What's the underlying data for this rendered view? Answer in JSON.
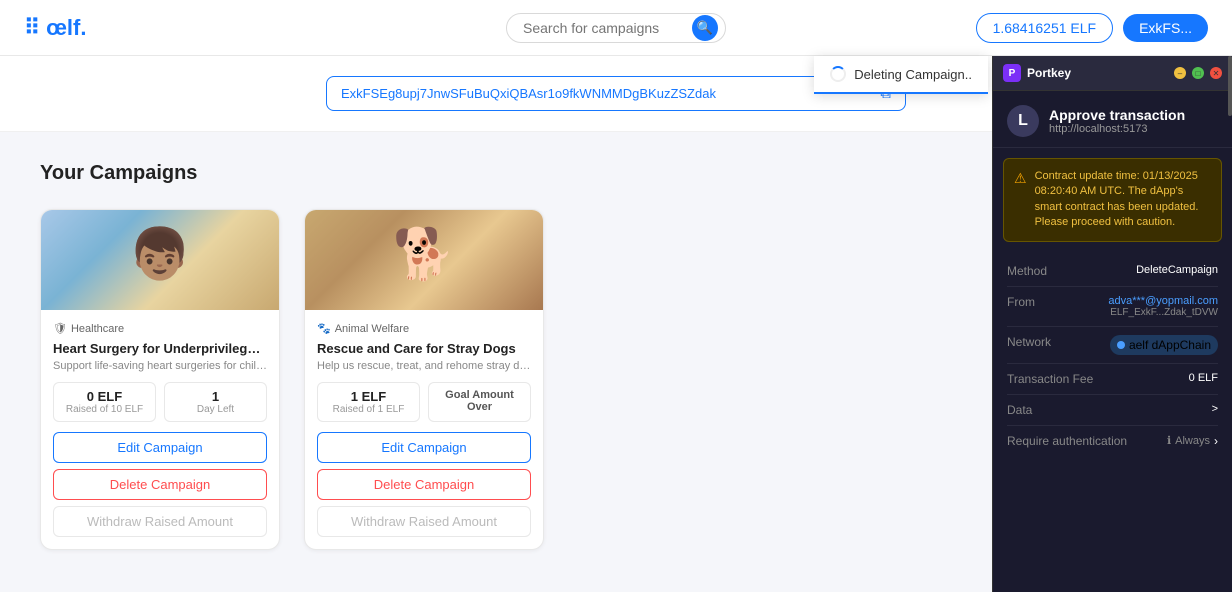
{
  "header": {
    "logo_text": "œlf.",
    "search_placeholder": "Search for campaigns",
    "balance": "1.68416251 ELF",
    "wallet_label": "ExkFS..."
  },
  "address_bar": {
    "address": "ExkFSEg8upj7JnwSFuBuQxiQBAsr1o9fkWNMMDgBKuzZSZdak",
    "copy_tooltip": "Copy address"
  },
  "section_title": "Your Campaigns",
  "campaigns": [
    {
      "id": "campaign-1",
      "category": "Healthcare",
      "title": "Heart Surgery for Underprivileged C...",
      "description": "Support life-saving heart surgeries for child...",
      "raised": "0 ELF",
      "raised_label": "Raised of 10 ELF",
      "time_left": "1",
      "time_left_label": "Day Left",
      "edit_label": "Edit Campaign",
      "delete_label": "Delete Campaign",
      "withdraw_label": "Withdraw Raised Amount",
      "status": null
    },
    {
      "id": "campaign-2",
      "category": "Animal Welfare",
      "title": "Rescue and Care for Stray Dogs",
      "description": "Help us rescue, treat, and rehome stray dogs ...",
      "raised": "1 ELF",
      "raised_label": "Raised of 1 ELF",
      "time_left": null,
      "time_left_label": null,
      "status_label": "Goal Amount Over",
      "edit_label": "Edit Campaign",
      "delete_label": "Delete Campaign",
      "withdraw_label": "Withdraw Raised Amount"
    }
  ],
  "deleting": {
    "text": "Deleting Campaign.."
  },
  "portkey": {
    "title": "Portkey",
    "header_title": "Approve transaction",
    "header_url": "http://localhost:5173",
    "avatar_letter": "L",
    "warning_text": "Contract update time: 01/13/2025 08:20:40 AM UTC. The dApp's smart contract has been updated. Please proceed with caution.",
    "method_label": "Method",
    "method_value": "DeleteCampaign",
    "from_label": "From",
    "from_email": "adva***@yopmail.com",
    "from_address": "ELF_ExkF...Zdak_tDVW",
    "network_label": "Network",
    "network_value": "aelf dAppChain",
    "fee_label": "Transaction Fee",
    "fee_value": "0 ELF",
    "data_label": "Data",
    "data_chevron": ">",
    "require_label": "Require authentication",
    "require_value": "Always",
    "require_chevron": ">"
  }
}
